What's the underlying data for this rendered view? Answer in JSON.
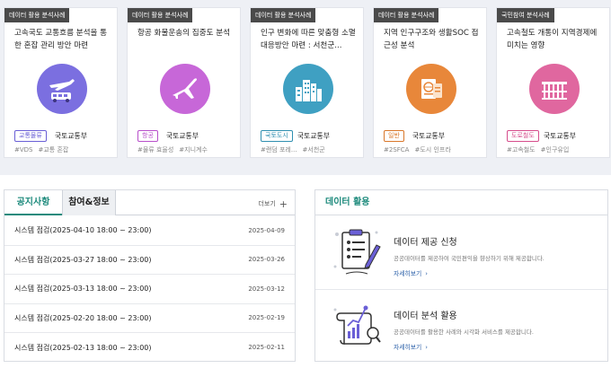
{
  "cards": [
    {
      "tag": "데이터 활용 분석사례",
      "title": "고속국도 교통흐름 분석을 통한 혼잡 관리 방안 마련",
      "category": "교통물류",
      "org": "국토교통부",
      "tags": [
        "#VDS",
        "#교통 혼잡"
      ],
      "circle_color": "#7b6fe0",
      "cat_color": "#6a5fd6",
      "icon": "plane-bus-icon"
    },
    {
      "tag": "데이터 활용 분석사례",
      "title": "항공 화물운송의 집중도 분석",
      "category": "항공",
      "org": "국토교통부",
      "tags": [
        "#물류 효율성",
        "#지니계수"
      ],
      "circle_color": "#c767d8",
      "cat_color": "#b84fcb",
      "icon": "airplane-icon"
    },
    {
      "tag": "데이터 활용 분석사례",
      "title": "인구 변화에 따른 맞춤형 소멸 대응방안 마련 : 서천군...",
      "category": "국토도시",
      "org": "국토교통부",
      "tags": [
        "#랜덤 포레...",
        "#서천군"
      ],
      "circle_color": "#3fa0c2",
      "cat_color": "#2f8fb0",
      "icon": "city-buildings-icon"
    },
    {
      "tag": "데이터 활용 분석사례",
      "title": "지역 인구구조와 생활SOC 접근성 분석",
      "category": "일반",
      "org": "국토교통부",
      "tags": [
        "#2SFCA",
        "#도시 인프라"
      ],
      "circle_color": "#e8873a",
      "cat_color": "#d9772a",
      "icon": "passport-globe-icon"
    },
    {
      "tag": "국민참여 분석사례",
      "title": "고속철도 개통이 지역경제에 미치는 영향",
      "category": "도로철도",
      "org": "국토교통부",
      "tags": [
        "#고속철도",
        "#인구유입"
      ],
      "circle_color": "#e0679f",
      "cat_color": "#d64d8c",
      "icon": "railway-bridge-icon"
    }
  ],
  "notice": {
    "tabs": [
      "공지사항",
      "참여&정보"
    ],
    "more_label": "더보기",
    "rows": [
      {
        "title": "시스템 점검(2025-04-10 18:00 ~ 23:00)",
        "date": "2025-04-09"
      },
      {
        "title": "시스템 점검(2025-03-27 18:00 ~ 23:00)",
        "date": "2025-03-26"
      },
      {
        "title": "시스템 점검(2025-03-13 18:00 ~ 23:00)",
        "date": "2025-03-12"
      },
      {
        "title": "시스템 점검(2025-02-20 18:00 ~ 23:00)",
        "date": "2025-02-19"
      },
      {
        "title": "시스템 점검(2025-02-13 18:00 ~ 23:00)",
        "date": "2025-02-11"
      }
    ]
  },
  "data_usage": {
    "heading": "데이터 활용",
    "items": [
      {
        "title": "데이터 제공 신청",
        "desc": "공공데이터를 제공하여 국민편익을 향상하기 위해 제공합니다.",
        "link": "자세히보기",
        "icon": "clipboard-pen-icon"
      },
      {
        "title": "데이터 분석 활용",
        "desc": "공공데이터를 활용한 사례와 시각화 서비스를 제공합니다.",
        "link": "자세히보기",
        "icon": "scroll-chart-icon"
      }
    ]
  }
}
